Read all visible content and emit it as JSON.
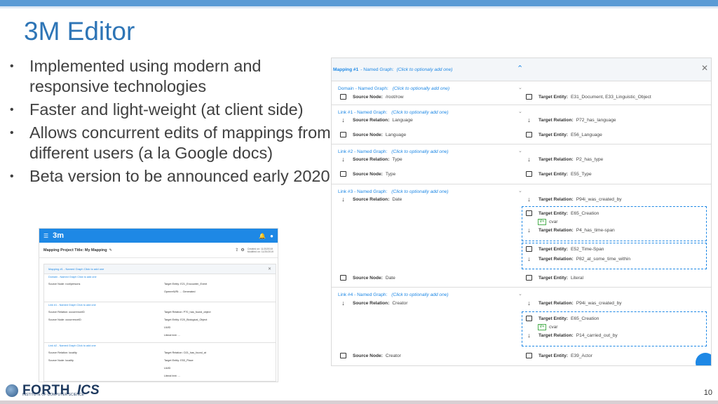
{
  "slide": {
    "title": "3M Editor",
    "bullets": [
      "Implemented using modern and responsive technologies",
      "Faster and light-weight (at client side)",
      "Allows concurrent edits of mappings from different users (a la Google docs)",
      "Beta version to be announced early 2020"
    ],
    "page_number": "10",
    "logo": {
      "main": "FORTH",
      "second": "ICS",
      "sub": "INSTITUTE OF COMPUTER SCIENCE"
    }
  },
  "small_shot": {
    "brand": "3m",
    "project_title": "Mapping Project Title:  My Mapping",
    "meta_created": "Created on: 11/20/2019",
    "meta_modified": "Modified on: 11/20/2019",
    "mapping_header": "Mapping #1 - Named Graph  Click to add one",
    "blocks": [
      {
        "header": "Domain - Named Graph  Click to add one",
        "lines": [
          {
            "left": "Source Node: root/persons",
            "right": "Target Entity: E21_Encounter_Event"
          },
          {
            "left": "",
            "right": "OpenrefURI: ... Generated"
          }
        ]
      },
      {
        "header": "Link #1 - Named Graph  Click to add one",
        "lines": [
          {
            "left": "Source Relation: occurrenceID",
            "right": "Target Relation: P70_has_found_object"
          },
          {
            "left": "Source Node: occurrenceID",
            "right": "Target Entity: E20_Biological_Object"
          },
          {
            "left": "",
            "right": "UUID"
          },
          {
            "left": "",
            "right": "Literal  text: ..."
          }
        ]
      },
      {
        "header": "Link #2 - Named Graph  Click to add one",
        "lines": [
          {
            "left": "Source Relation: locality",
            "right": "Target Relation: O21_has_found_at"
          },
          {
            "left": "Source Node: locality",
            "right": "Target Entity: E53_Place"
          },
          {
            "left": "",
            "right": "UUID"
          },
          {
            "left": "",
            "right": "Literal  text: ..."
          }
        ]
      }
    ]
  },
  "big_shot": {
    "mapping": {
      "label": "Mapping #1",
      "named_graph": "- Named Graph:",
      "hint": "(Click to optionaly add one)"
    },
    "domain": {
      "label": "Domain",
      "named_graph": "- Named Graph:",
      "hint": "(Click to optionally add one)",
      "source_node_key": "Source Node:",
      "source_node_val": "/root/row",
      "target_entity_key": "Target Entity:",
      "target_entity_val": "E31_Document,  E33_Linguistic_Object"
    },
    "link1": {
      "label": "Link #1",
      "named_graph": "- Named Graph:",
      "hint": "(Click to optionally add one)",
      "src_rel_key": "Source Relation:",
      "src_rel_val": "Language",
      "tgt_rel_key": "Target Relation:",
      "tgt_rel_val": "P72_has_language",
      "src_node_key": "Source Node:",
      "src_node_val": "Language",
      "tgt_ent_key": "Target Entity:",
      "tgt_ent_val": "E56_Language"
    },
    "link2": {
      "label": "Link #2",
      "named_graph": "- Named Graph:",
      "hint": "(Click to optionally add one)",
      "src_rel_key": "Source Relation:",
      "src_rel_val": "Type",
      "tgt_rel_key": "Target Relation:",
      "tgt_rel_val": "P2_has_type",
      "src_node_key": "Source Node:",
      "src_node_val": "Type",
      "tgt_ent_key": "Target Entity:",
      "tgt_ent_val": "E55_Type"
    },
    "link3": {
      "label": "Link #3",
      "named_graph": "- Named Graph:",
      "hint": "(Click to optionally add one)",
      "src_rel_key": "Source Relation:",
      "src_rel_val": "Date",
      "tgt_rel_key": "Target Relation:",
      "tgt_rel_val": "P94i_was_created_by",
      "int1_ent_key": "Target Entity:",
      "int1_ent_val": "E65_Creation",
      "int1_var": "cvar",
      "int1_rel_key": "Target Relation:",
      "int1_rel_val": "P4_has_time-span",
      "int2_ent_key": "Target Entity:",
      "int2_ent_val": "E52_Time-Span",
      "int2_rel_key": "Target Relation:",
      "int2_rel_val": "P82_at_some_time_within",
      "src_node_key": "Source Node:",
      "src_node_val": "Date",
      "tgt_ent_key": "Target Entity:",
      "tgt_ent_val": "Literal"
    },
    "link4": {
      "label": "Link #4",
      "named_graph": "- Named Graph:",
      "hint": "(Click to optionally add one)",
      "src_rel_key": "Source Relation:",
      "src_rel_val": "Creator",
      "tgt_rel_key": "Target Relation:",
      "tgt_rel_val": "P94i_was_created_by",
      "int1_ent_key": "Target Entity:",
      "int1_ent_val": "E65_Creation",
      "int1_var": "cvar",
      "int1_rel_key": "Target Relation:",
      "int1_rel_val": "P14_carried_out_by",
      "src_node_key": "Source Node:",
      "src_node_val": "Creator",
      "tgt_ent_key": "Target Entity:",
      "tgt_ent_val": "E39_Actor"
    }
  }
}
